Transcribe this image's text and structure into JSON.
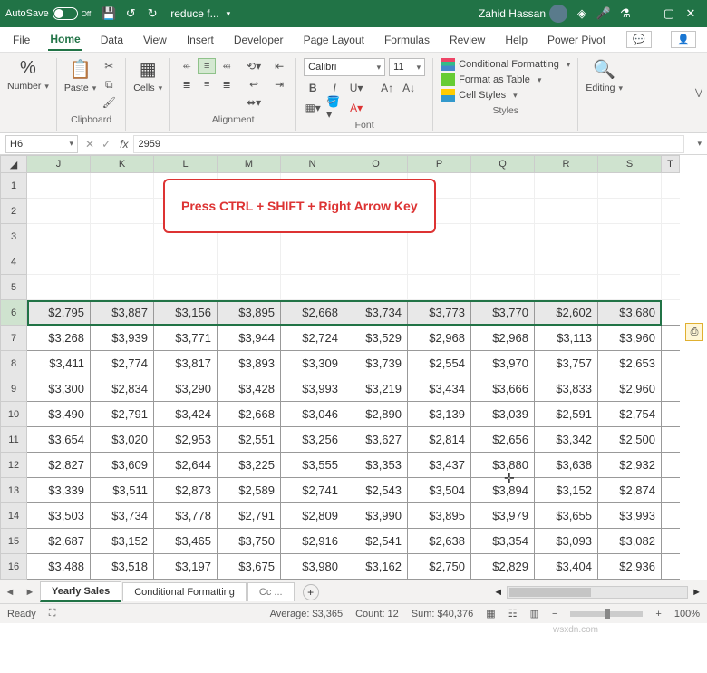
{
  "titlebar": {
    "autosave": "AutoSave",
    "autosave_state": "Off",
    "doc": "reduce f...",
    "user": "Zahid Hassan"
  },
  "menu": {
    "file": "File",
    "home": "Home",
    "data": "Data",
    "view": "View",
    "insert": "Insert",
    "developer": "Developer",
    "page_layout": "Page Layout",
    "formulas": "Formulas",
    "review": "Review",
    "help": "Help",
    "power_pivot": "Power Pivot"
  },
  "ribbon": {
    "number": "Number",
    "paste": "Paste",
    "clipboard": "Clipboard",
    "cells": "Cells",
    "alignment": "Alignment",
    "font_group": "Font",
    "font": "Calibri",
    "size": "11",
    "styles_group": "Styles",
    "cond_fmt": "Conditional Formatting",
    "fmt_table": "Format as Table",
    "cell_styles": "Cell Styles",
    "editing": "Editing"
  },
  "name_box": "H6",
  "formula": "2959",
  "col_headers": [
    "J",
    "K",
    "L",
    "M",
    "N",
    "O",
    "P",
    "Q",
    "R",
    "S",
    "T"
  ],
  "row_headers": [
    "1",
    "2",
    "3",
    "4",
    "5",
    "6",
    "7",
    "8",
    "9",
    "10",
    "11",
    "12",
    "13",
    "14",
    "15",
    "16"
  ],
  "callout": "Press CTRL + SHIFT + Right Arrow Key",
  "sheets": {
    "prev": "◄",
    "next": "►",
    "s1": "Yearly Sales",
    "s2": "Conditional Formatting",
    "s3": "Cc",
    "more": "..."
  },
  "status": {
    "ready": "Ready",
    "avg": "Average: $3,365",
    "count": "Count: 12",
    "sum": "Sum: $40,376",
    "zoom": "100%"
  },
  "chart_data": {
    "type": "table",
    "columns": [
      "J",
      "K",
      "L",
      "M",
      "N",
      "O",
      "P",
      "Q",
      "R",
      "S"
    ],
    "rows": [
      [
        "$2,795",
        "$3,887",
        "$3,156",
        "$3,895",
        "$2,668",
        "$3,734",
        "$3,773",
        "$3,770",
        "$2,602",
        "$3,680"
      ],
      [
        "$3,268",
        "$3,939",
        "$3,771",
        "$3,944",
        "$2,724",
        "$3,529",
        "$2,968",
        "$2,968",
        "$3,113",
        "$3,960"
      ],
      [
        "$3,411",
        "$2,774",
        "$3,817",
        "$3,893",
        "$3,309",
        "$3,739",
        "$2,554",
        "$3,970",
        "$3,757",
        "$2,653"
      ],
      [
        "$3,300",
        "$2,834",
        "$3,290",
        "$3,428",
        "$3,993",
        "$3,219",
        "$3,434",
        "$3,666",
        "$3,833",
        "$2,960"
      ],
      [
        "$3,490",
        "$2,791",
        "$3,424",
        "$2,668",
        "$3,046",
        "$2,890",
        "$3,139",
        "$3,039",
        "$2,591",
        "$2,754"
      ],
      [
        "$3,654",
        "$3,020",
        "$2,953",
        "$2,551",
        "$3,256",
        "$3,627",
        "$2,814",
        "$2,656",
        "$3,342",
        "$2,500"
      ],
      [
        "$2,827",
        "$3,609",
        "$2,644",
        "$3,225",
        "$3,555",
        "$3,353",
        "$3,437",
        "$3,880",
        "$3,638",
        "$2,932"
      ],
      [
        "$3,339",
        "$3,511",
        "$2,873",
        "$2,589",
        "$2,741",
        "$2,543",
        "$3,504",
        "$3,894",
        "$3,152",
        "$2,874"
      ],
      [
        "$3,503",
        "$3,734",
        "$3,778",
        "$2,791",
        "$2,809",
        "$3,990",
        "$3,895",
        "$3,979",
        "$3,655",
        "$3,993"
      ],
      [
        "$2,687",
        "$3,152",
        "$3,465",
        "$3,750",
        "$2,916",
        "$2,541",
        "$2,638",
        "$3,354",
        "$3,093",
        "$3,082"
      ],
      [
        "$3,488",
        "$3,518",
        "$3,197",
        "$3,675",
        "$3,980",
        "$3,162",
        "$2,750",
        "$2,829",
        "$3,404",
        "$2,936"
      ]
    ]
  },
  "wmark": "wsxdn.com"
}
